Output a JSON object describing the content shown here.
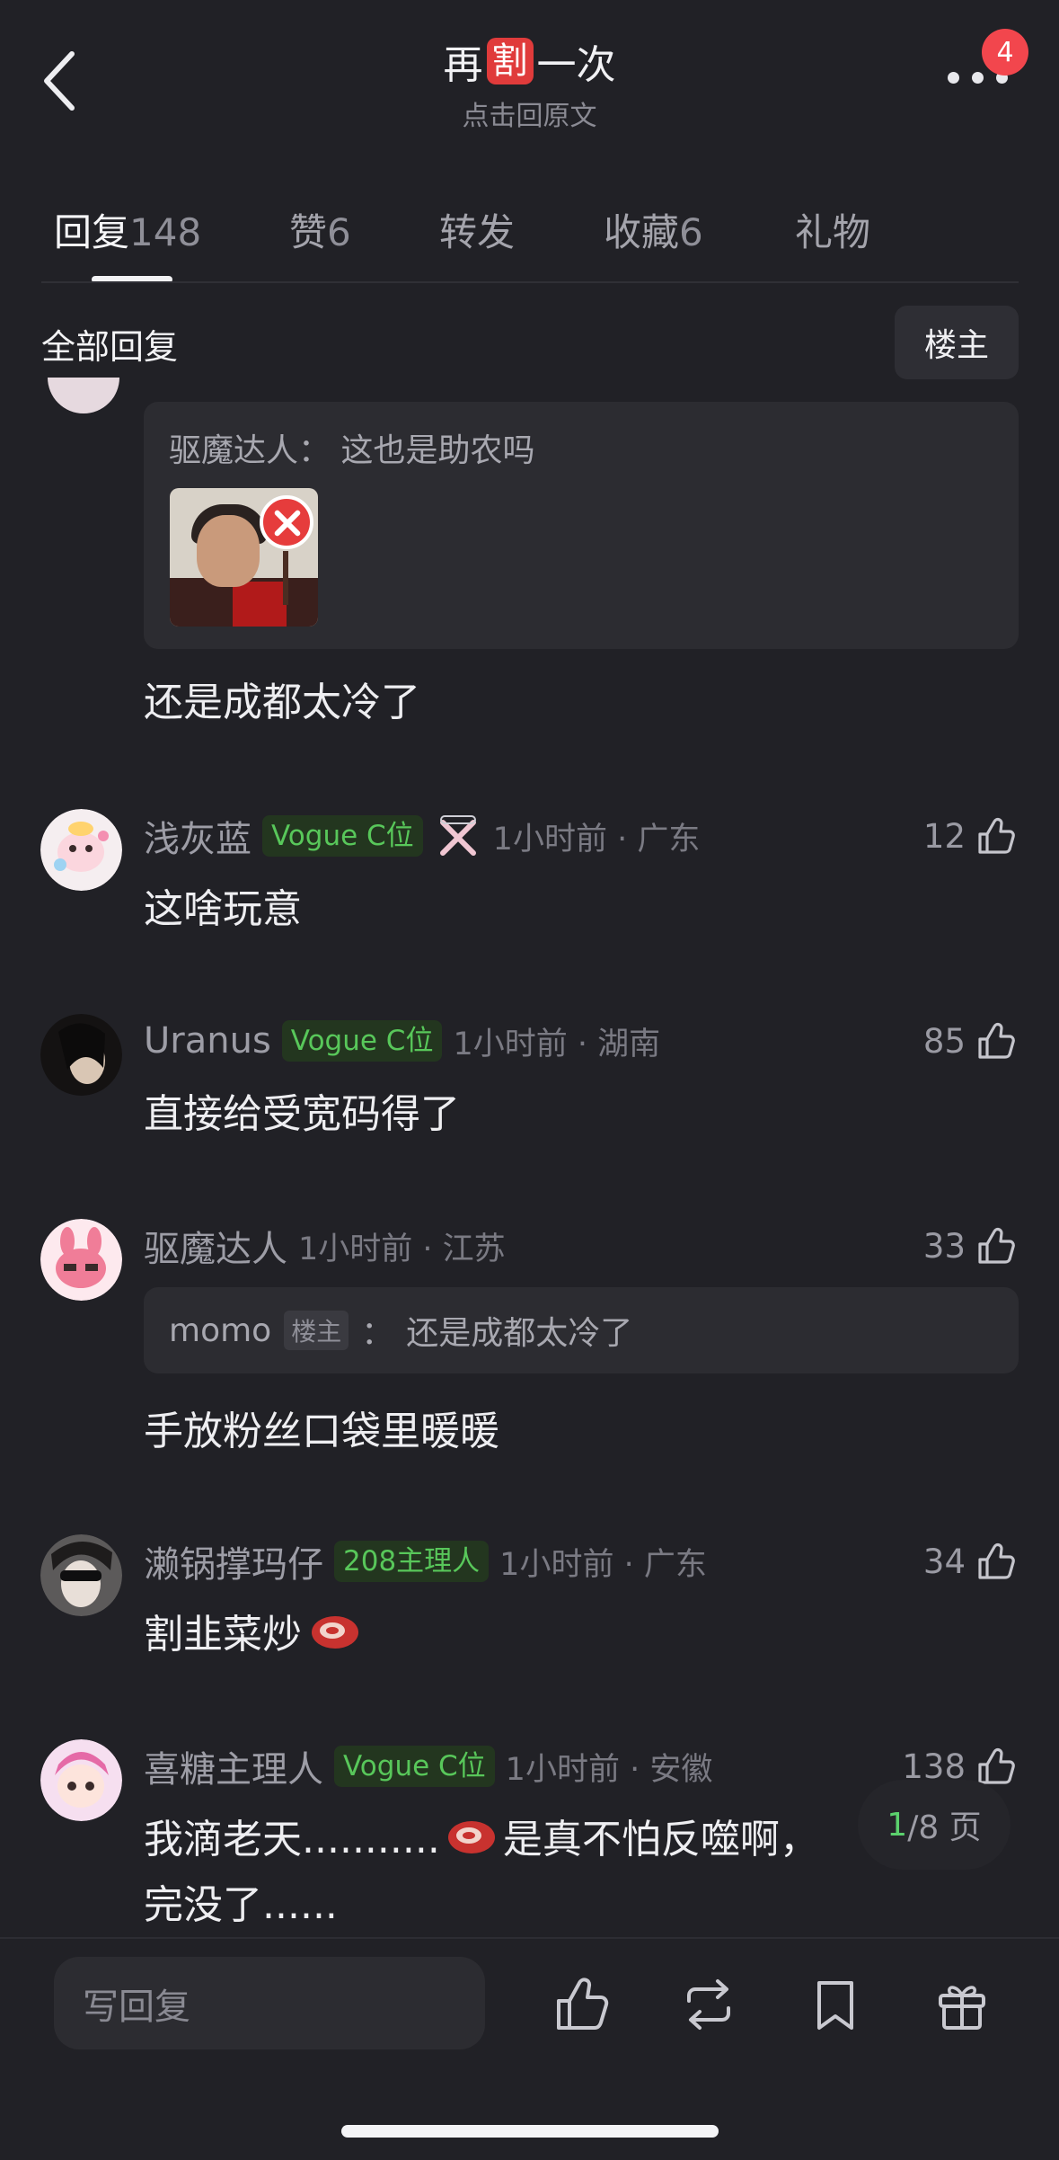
{
  "header": {
    "title_before": "再",
    "title_badge": "割",
    "title_after": "一次",
    "subtitle": "点击回原文",
    "notification_count": "4"
  },
  "tabs": [
    {
      "label": "回复",
      "count": "148"
    },
    {
      "label": "赞",
      "count": "6"
    },
    {
      "label": "转发",
      "count": ""
    },
    {
      "label": "收藏",
      "count": "6"
    },
    {
      "label": "礼物",
      "count": ""
    }
  ],
  "filter": {
    "label": "全部回复",
    "op_button": "楼主"
  },
  "top_reply": {
    "quote_author": "驱魔达人",
    "quote_text": "这也是助农吗",
    "text": "还是成都太冷了"
  },
  "comments": [
    {
      "username": "浅灰蓝",
      "tag": "Vogue C位",
      "time": "1小时前 · 广东",
      "likes": "12",
      "text": "这啥玩意",
      "avatar_color": "#f4e6ea"
    },
    {
      "username": "Uranus",
      "tag": "Vogue C位",
      "time": "1小时前 · 湖南",
      "likes": "85",
      "text": "直接给受宽码得了",
      "avatar_color": "#1d1b1a"
    },
    {
      "username": "驱魔达人",
      "tag": "",
      "time": "1小时前 · 江苏",
      "likes": "33",
      "text": "手放粉丝口袋里暖暖",
      "avatar_color": "#f6c8d2",
      "quote": {
        "name": "momo",
        "op_label": "楼主",
        "sep": "：",
        "text": "还是成都太冷了"
      }
    },
    {
      "username": "濑锅撑玛仔",
      "tag": "208主理人",
      "time": "1小时前 · 广东",
      "likes": "34",
      "text": "割韭菜炒",
      "avatar_color": "#3b3b3f"
    },
    {
      "username": "喜糖主理人",
      "tag": "Vogue C位",
      "time": "1小时前 · 安徽",
      "likes": "138",
      "text": "我滴老天...........",
      "text2": "是真不怕反噬啊，",
      "text3": "完没了......",
      "avatar_color": "#f3d3e6"
    }
  ],
  "pagination": {
    "current": "1",
    "total": "/8 页"
  },
  "bottom_bar": {
    "placeholder": "写回复"
  },
  "colors": {
    "background": "#212126",
    "accent_green": "#58c75a",
    "badge_red": "#f2464d"
  }
}
